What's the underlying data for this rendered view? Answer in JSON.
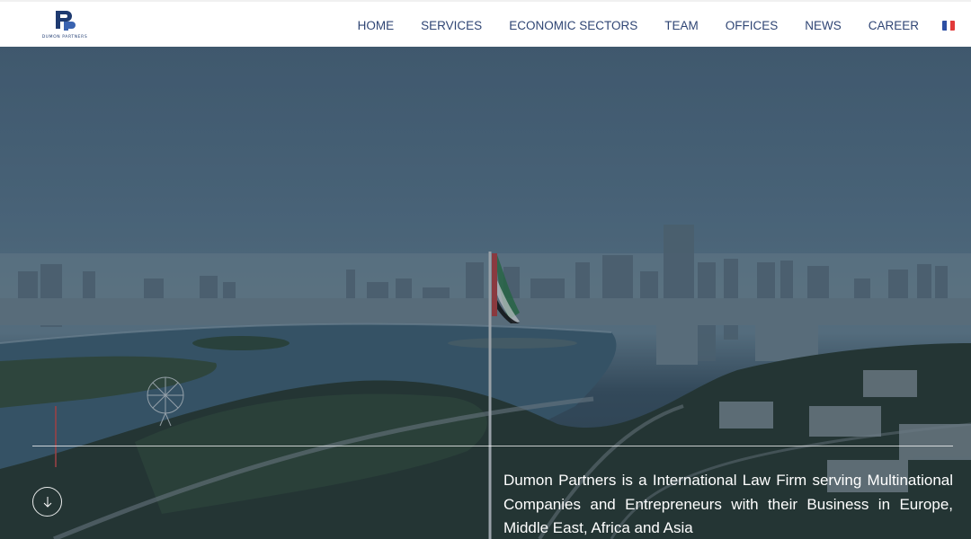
{
  "brand": {
    "name": "DUMON PARTNERS",
    "logo_icon": "dp-monogram-logo",
    "color": "#1e3a70"
  },
  "nav": {
    "items": [
      {
        "label": "HOME"
      },
      {
        "label": "SERVICES"
      },
      {
        "label": "ECONOMIC SECTORS"
      },
      {
        "label": "TEAM"
      },
      {
        "label": "OFFICES"
      },
      {
        "label": "NEWS"
      },
      {
        "label": "CAREER"
      }
    ],
    "language_icon": "french-flag-icon",
    "text_color": "#2f4574"
  },
  "hero": {
    "image_subject": "aerial city skyline with lagoon, ferris wheel and flag",
    "tagline": "Dumon Partners is a International Law Firm serving Multinational Companies and Entrepreneurs with their Business in Europe, Middle East, Africa and Asia",
    "scroll_icon": "arrow-down-icon"
  }
}
